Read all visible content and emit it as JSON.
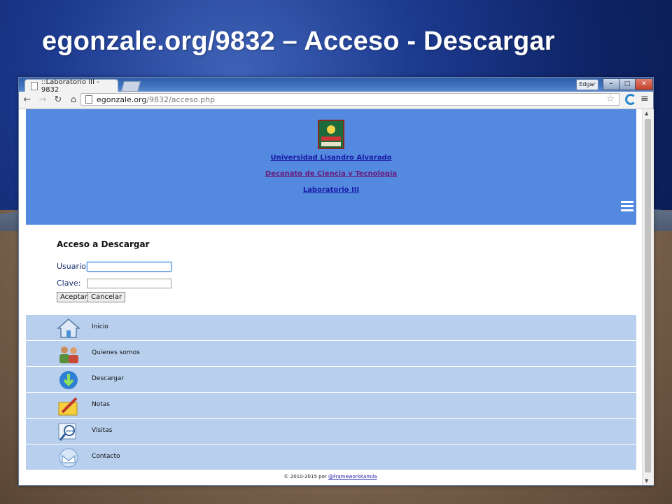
{
  "slide": {
    "title": "egonzale.org/9832 – Acceso - Descargar"
  },
  "browser": {
    "tab_title": "::Laboratorio III - 9832",
    "user_label": "Edgar",
    "url_host": "egonzale.org",
    "url_path": "/9832/acceso.php"
  },
  "header": {
    "links": [
      "Universidad Lisandro Alvarado",
      "Decanato de Ciencia y Tecnología",
      "Laboratorio III"
    ]
  },
  "form": {
    "title": "Acceso a Descargar",
    "user_label": "Usuario:",
    "pass_label": "Clave:",
    "accept": "Aceptar",
    "cancel": "Cancelar"
  },
  "menu": {
    "items": [
      {
        "label": "Inicio",
        "icon": "home-icon"
      },
      {
        "label": "Quienes somos",
        "icon": "people-icon"
      },
      {
        "label": "Descargar",
        "icon": "download-icon"
      },
      {
        "label": "Notas",
        "icon": "notepad-icon"
      },
      {
        "label": "Visitas",
        "icon": "www-icon"
      },
      {
        "label": "Contacto",
        "icon": "mail-icon"
      }
    ]
  },
  "footer": {
    "text": "© 2010-2015 por ",
    "link": "@FrameworkKamila"
  },
  "colors": {
    "header_bg": "#5389de",
    "menu_bg": "#b8cfee"
  }
}
